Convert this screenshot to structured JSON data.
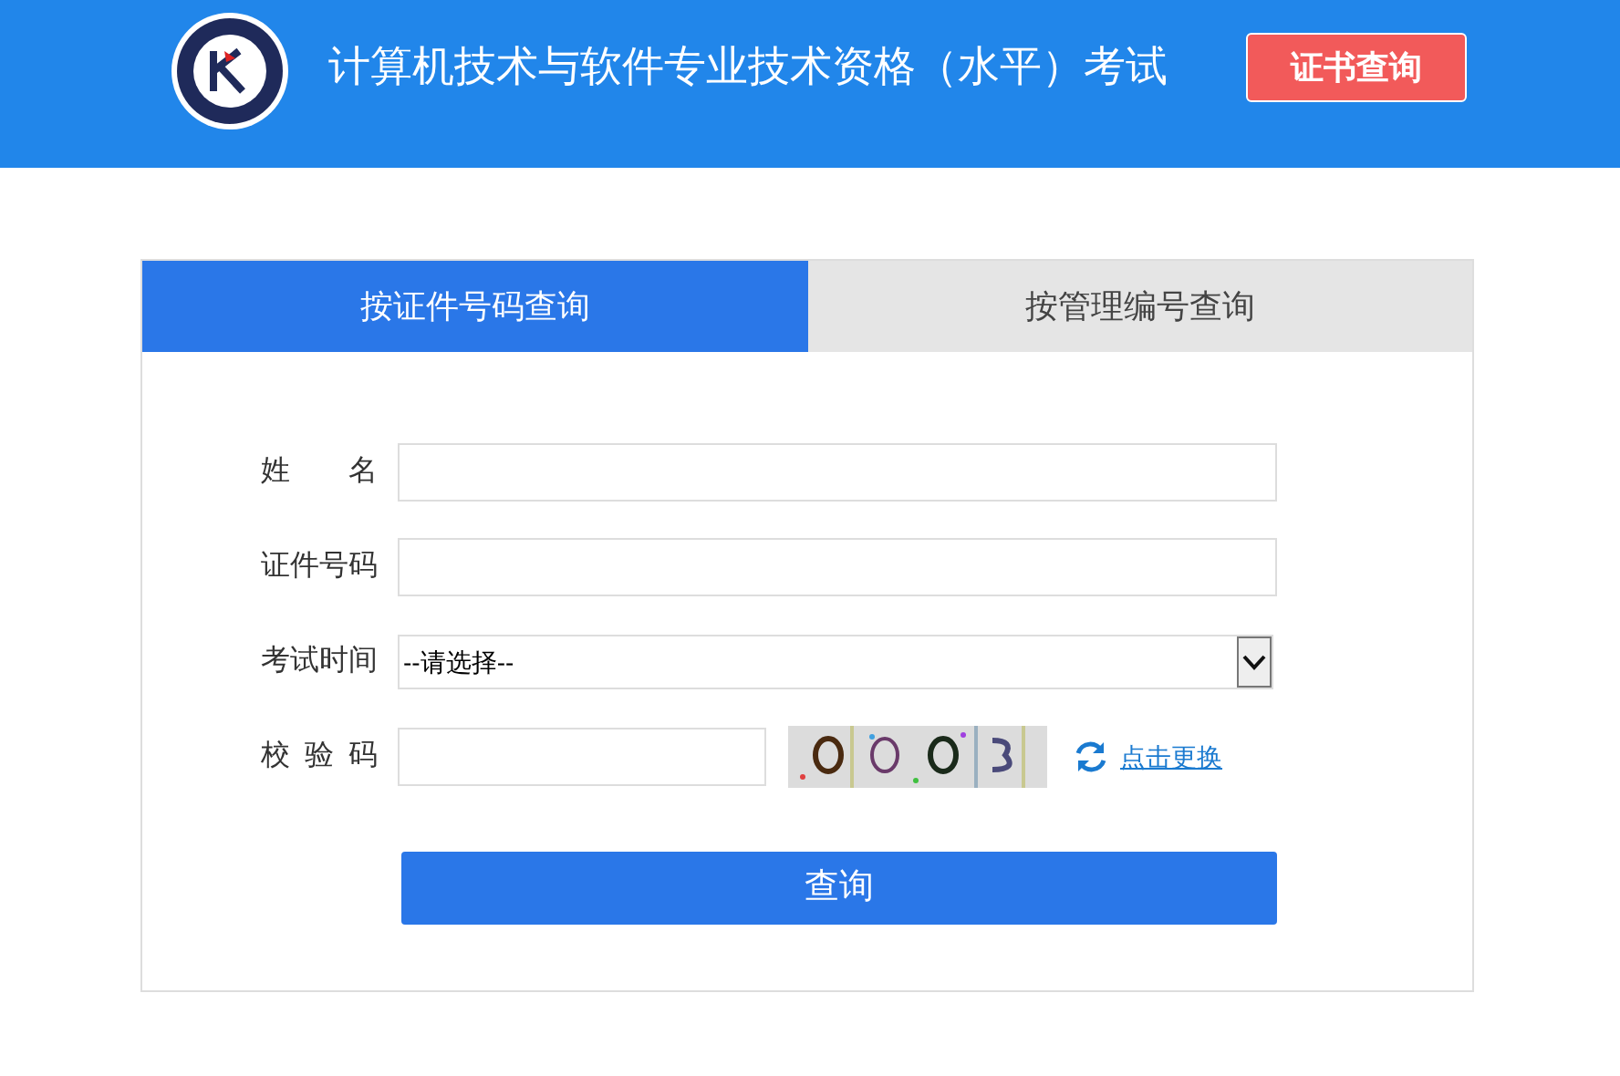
{
  "header": {
    "title": "计算机技术与软件专业技术资格（水平）考试",
    "action_button": "证书查询"
  },
  "tabs": [
    {
      "label": "按证件号码查询",
      "selected": true
    },
    {
      "label": "按管理编号查询",
      "selected": false
    }
  ],
  "form": {
    "fields": [
      {
        "kind": "text",
        "label": "姓名"
      },
      {
        "kind": "text",
        "label": "证件号码"
      },
      {
        "kind": "select",
        "label": "考试时间",
        "value": "--请选择--"
      },
      {
        "kind": "captcha",
        "label": "校验码",
        "refresh_link": "点击更换"
      }
    ],
    "submit_button": "查询"
  }
}
